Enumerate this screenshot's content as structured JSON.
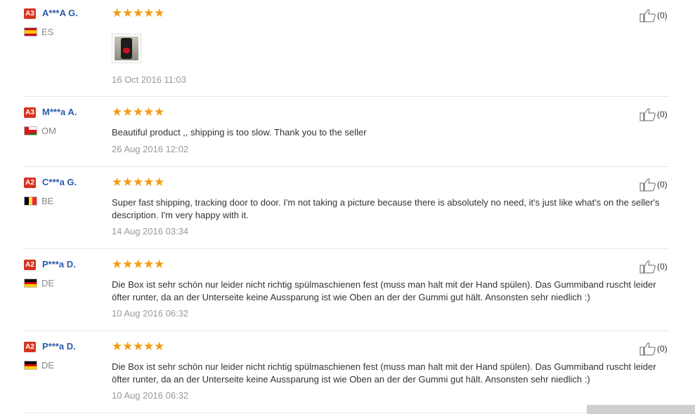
{
  "reviews": [
    {
      "level": "A3",
      "name": "A***A G.",
      "country": "ES",
      "flag": "es",
      "stars": 5,
      "text": "",
      "has_photo": true,
      "date": "16 Oct 2016 11:03",
      "likes": "(0)"
    },
    {
      "level": "A3",
      "name": "M***a A.",
      "country": "OM",
      "flag": "om",
      "stars": 5,
      "text": "Beautiful product ,, shipping is too slow. Thank you to the seller",
      "has_photo": false,
      "date": "26 Aug 2016 12:02",
      "likes": "(0)"
    },
    {
      "level": "A2",
      "name": "C***a G.",
      "country": "BE",
      "flag": "be",
      "stars": 5,
      "text": "Super fast shipping, tracking door to door. I'm not taking a picture because there is absolutely no need, it's just like what's on the seller's description. I'm very happy with it.",
      "has_photo": false,
      "date": "14 Aug 2016 03:34",
      "likes": "(0)"
    },
    {
      "level": "A2",
      "name": "P***a D.",
      "country": "DE",
      "flag": "de",
      "stars": 5,
      "text": "Die Box ist sehr schön nur leider nicht richtig spülmaschienen fest (muss man halt mit der Hand spülen). Das Gummiband ruscht leider öfter runter, da an der Unterseite keine Aussparung ist wie Oben an der der Gummi gut hält. Ansonsten sehr niedlich :)",
      "has_photo": false,
      "date": "10 Aug 2016 06:32",
      "likes": "(0)"
    },
    {
      "level": "A2",
      "name": "P***a D.",
      "country": "DE",
      "flag": "de",
      "stars": 5,
      "text": "Die Box ist sehr schön nur leider nicht richtig spülmaschienen fest (muss man halt mit der Hand spülen). Das Gummiband ruscht leider öfter runter, da an der Unterseite keine Aussparung ist wie Oben an der der Gummi gut hält. Ansonsten sehr niedlich :)",
      "has_photo": false,
      "date": "10 Aug 2016 06:32",
      "likes": "(0)"
    }
  ],
  "colors": {
    "star": "#f39b12",
    "badge": "#d6341f",
    "name": "#2a5ca8",
    "date": "#999999"
  },
  "icons": {
    "star": "star-icon",
    "like": "thumbs-up-icon"
  }
}
